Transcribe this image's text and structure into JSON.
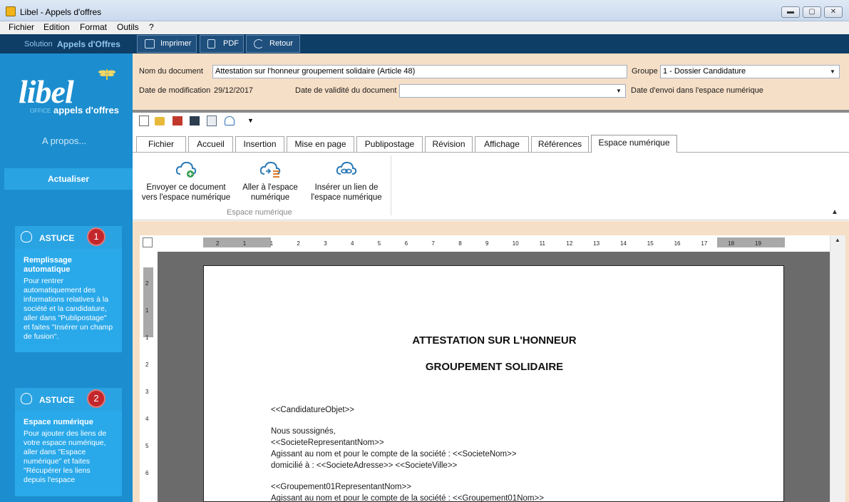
{
  "window": {
    "title": "Libel - Appels d'offres",
    "min": "▬",
    "max": "▢",
    "close": "✕"
  },
  "menu": [
    "Fichier",
    "Edition",
    "Format",
    "Outils",
    "?"
  ],
  "toolbar": {
    "solution_label": "Solution",
    "solution_name": "Appels d'Offres",
    "print": "Imprimer",
    "pdf": "PDF",
    "back": "Retour"
  },
  "sidebar": {
    "logo": "libel",
    "logo_office": "OFFICE",
    "logo_sub": "appels d'offres",
    "apropos": "A propos...",
    "refresh": "Actualiser",
    "tips": [
      {
        "label": "ASTUCE",
        "number": "1",
        "title": "Remplissage automatique",
        "text": "Pour rentrer automatiquement des informations relatives à la société et la candidature, aller dans \"Publipostage\" et faites \"Insérer un champ de fusion\"."
      },
      {
        "label": "ASTUCE",
        "number": "2",
        "title": "Espace numérique",
        "text": "Pour ajouter des liens de votre espace numérique, aller dans \"Espace numérique\" et faites \"Récupérer les liens depuis l'espace"
      }
    ]
  },
  "props": {
    "doc_name_label": "Nom du document",
    "doc_name_value": "Attestation sur l'honneur groupement solidaire (Article 48)",
    "group_label": "Groupe",
    "group_value": "1 - Dossier Candidature",
    "modified_label": "Date de modification",
    "modified_value": "29/12/2017",
    "validity_label": "Date de validité du document",
    "validity_value": "",
    "sent_label": "Date d'envoi dans l'espace numérique"
  },
  "tabs": [
    "Fichier",
    "Accueil",
    "Insertion",
    "Mise en page",
    "Publipostage",
    "Révision",
    "Affichage",
    "Références",
    "Espace numérique"
  ],
  "ribbon": {
    "buttons": [
      {
        "line1": "Envoyer ce document",
        "line2": "vers l'espace numérique"
      },
      {
        "line1": "Aller à l'espace",
        "line2": "numérique"
      },
      {
        "line1": "Insérer un lien de",
        "line2": "l'espace numérique"
      }
    ],
    "group_label": "Espace numérique"
  },
  "ruler": {
    "h_ticks": [
      "2",
      "1",
      "1",
      "2",
      "3",
      "4",
      "5",
      "6",
      "7",
      "8",
      "9",
      "10",
      "11",
      "12",
      "13",
      "14",
      "15",
      "16",
      "17",
      "18",
      "19"
    ],
    "v_ticks": [
      "2",
      "1",
      "1",
      "2",
      "3",
      "4",
      "5",
      "6"
    ]
  },
  "document": {
    "title1": "ATTESTATION SUR L'HONNEUR",
    "title2": "GROUPEMENT SOLIDAIRE",
    "lines": [
      "<<CandidatureObjet>>",
      "Nous soussignés,",
      "<<SocieteRepresentantNom>>",
      "Agissant au nom et pour le compte de la société : <<SocieteNom>>",
      "domicilié à : <<SocieteAdresse>> <<SocieteVille>>",
      "<<Groupement01RepresentantNom>>",
      "Agissant au nom et pour le compte de la société : <<Groupement01Nom>>"
    ]
  },
  "colors": {
    "sidebar": "#1c8ecf",
    "darkbar": "#0e3d66",
    "props_bg": "#f6dfc7",
    "badge": "#c3262b"
  }
}
